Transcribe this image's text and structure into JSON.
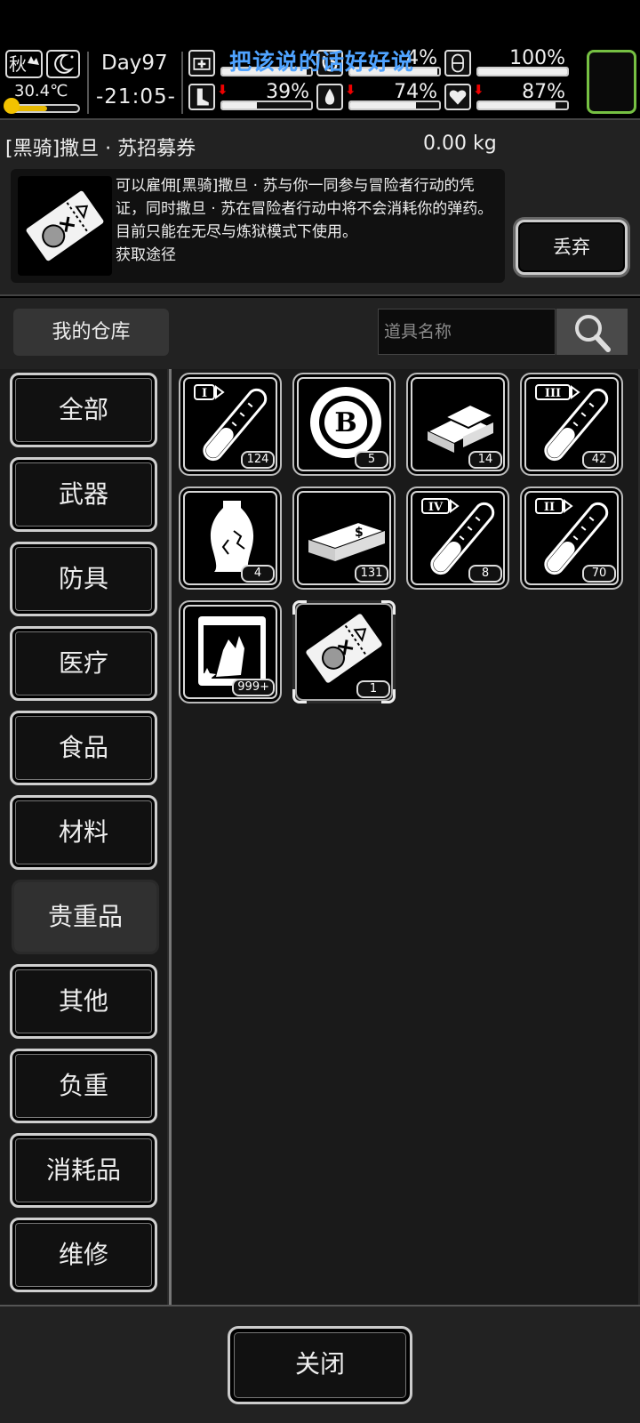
{
  "status": {
    "season": "秋",
    "temperature": "30.4℃",
    "temperature_fill": 0.55,
    "day": "Day97",
    "time": "-21:05-",
    "overlay_text": "把该说的话好好说",
    "meters": [
      {
        "icon": "medkit-icon",
        "value": "",
        "fill": 0.95,
        "arrow": false
      },
      {
        "icon": "stomach-icon",
        "value": "4%",
        "fill": 0.98,
        "arrow": false
      },
      {
        "icon": "pill-icon",
        "value": "100%",
        "fill": 1.0,
        "arrow": false
      },
      {
        "icon": "boot-icon",
        "value": "39%",
        "fill": 0.39,
        "arrow": true
      },
      {
        "icon": "water-drop-icon",
        "value": "74%",
        "fill": 0.74,
        "arrow": true
      },
      {
        "icon": "heart-icon",
        "value": "87%",
        "fill": 0.87,
        "arrow": true
      }
    ],
    "accent_color": "#76c043"
  },
  "detail": {
    "title": "[黑骑]撒旦 · 苏招募券",
    "weight": "0.00 kg",
    "description": "可以雇佣[黑骑]撒旦 · 苏与你一同参与冒险者行动的凭证，同时撒旦 · 苏在冒险者行动中将不会消耗你的弹药。目前只能在无尽与炼狱模式下使用。",
    "description_cut": "获取途径",
    "drop_label": "丢弃"
  },
  "search": {
    "warehouse_label": "我的仓库",
    "placeholder": "道具名称"
  },
  "categories": [
    {
      "label": "全部",
      "active": false
    },
    {
      "label": "武器",
      "active": false
    },
    {
      "label": "防具",
      "active": false
    },
    {
      "label": "医疗",
      "active": false
    },
    {
      "label": "食品",
      "active": false
    },
    {
      "label": "材料",
      "active": false
    },
    {
      "label": "贵重品",
      "active": true
    },
    {
      "label": "其他",
      "active": false
    },
    {
      "label": "负重",
      "active": false
    },
    {
      "label": "消耗品",
      "active": false
    },
    {
      "label": "维修",
      "active": false
    }
  ],
  "items": [
    {
      "icon": "test-tube-I-icon",
      "count": "124",
      "roman": "I"
    },
    {
      "icon": "bitcoin-chip-icon",
      "count": "5"
    },
    {
      "icon": "gold-bars-icon",
      "count": "14"
    },
    {
      "icon": "test-tube-III-icon",
      "count": "42",
      "roman": "III"
    },
    {
      "icon": "porcelain-vase-icon",
      "count": "4"
    },
    {
      "icon": "cash-stack-icon",
      "count": "131"
    },
    {
      "icon": "test-tube-IV-icon",
      "count": "8",
      "roman": "IV"
    },
    {
      "icon": "test-tube-II-icon",
      "count": "70",
      "roman": "II"
    },
    {
      "icon": "film-card-icon",
      "count": "999+"
    },
    {
      "icon": "recruit-ticket-icon",
      "count": "1",
      "selected": true
    }
  ],
  "close_label": "关闭"
}
